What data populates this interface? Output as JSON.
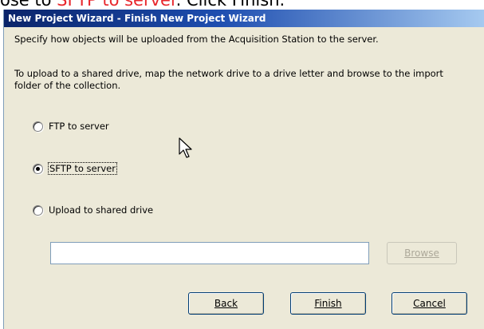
{
  "instruction": {
    "prefix": "ose to ",
    "highlight": "SFTP to server",
    "suffix": ". Click Finish.",
    "highlight_color": "#e8262c"
  },
  "dialog": {
    "title": "New Project Wizard - Finish New Project Wizard",
    "description_1": "Specify how objects will be uploaded from the Acquisition Station to the server.",
    "description_2": "To upload to a shared drive, map the network drive to a drive letter and browse to the import folder of the collection.",
    "options": [
      {
        "label": "FTP to server",
        "selected": false
      },
      {
        "label": "SFTP to server",
        "selected": true
      },
      {
        "label": "Upload to shared drive",
        "selected": false
      }
    ],
    "path_value": "",
    "browse_label": "Browse",
    "browse_enabled": false,
    "back_label": "Back",
    "finish_label": "Finish",
    "cancel_label": "Cancel"
  },
  "colors": {
    "title_gradient_start": "#0a246a",
    "dialog_bg": "#ece9d8"
  },
  "icons": {
    "cursor": "mouse-pointer-icon"
  }
}
